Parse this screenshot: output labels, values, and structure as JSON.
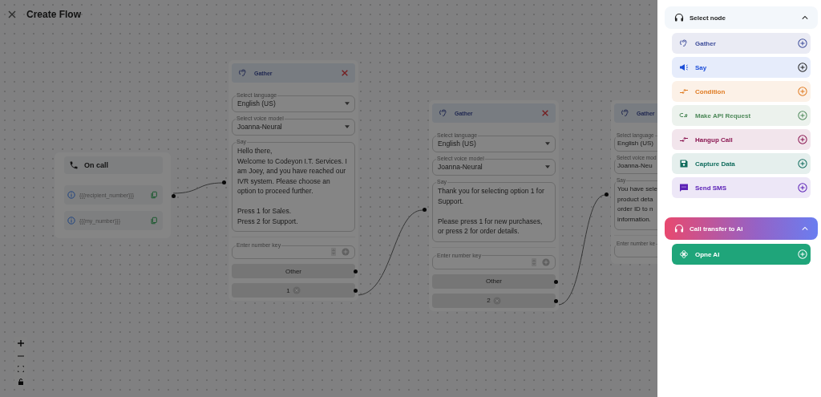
{
  "header": {
    "title": "Create Flow"
  },
  "nodes": [
    {
      "kind": "start",
      "title": "On call",
      "variables": [
        "{{{recipient_number}}}",
        "{{{my_number}}}"
      ]
    },
    {
      "kind": "gather",
      "title": "Gather",
      "closable": true,
      "language_label": "Select language",
      "language": "English (US)",
      "voice_label": "Select voice model",
      "voice": "Joanna-Neural",
      "say_label": "Say",
      "say": "Hello there,\nWelcome to Codeyon I.T. Services. I am Joey, and you have reached our IVR system. Please choose an option to proceed further.\n\nPress 1 for Sales.\nPress 2 for Support.",
      "number_label": "Enter number key",
      "options": [
        {
          "kind": "other",
          "label": "Other"
        },
        {
          "kind": "key",
          "label": "1"
        }
      ]
    },
    {
      "kind": "gather",
      "title": "Gather",
      "closable": true,
      "language_label": "Select language",
      "language": "English (US)",
      "voice_label": "Select voice model",
      "voice": "Joanna-Neural",
      "say_label": "Say",
      "say": "Thank you for selecting option 1 for Support.\n\nPlease press 1 for new purchases, or press 2 for order details.",
      "number_label": "Enter number key",
      "options": [
        {
          "kind": "other",
          "label": "Other"
        },
        {
          "kind": "key",
          "label": "2"
        }
      ]
    },
    {
      "kind": "gather",
      "title": "Gather",
      "closable": false,
      "language_label": "Select language",
      "language": "English (US)",
      "voice_label": "Select voice mod",
      "voice": "Joanna-Neu",
      "say_label": "Say",
      "say": "You have sele\nproduct deta\norder ID to n\ninformation.",
      "number_label": "Enter number ke"
    }
  ],
  "drawer": {
    "sections": [
      {
        "kind": "plain",
        "title": "Select node",
        "expanded": true,
        "items": [
          {
            "kind": "gather",
            "label": "Gather",
            "color": "#3d4c9a"
          },
          {
            "kind": "say",
            "label": "Say",
            "color": "#1d4ed8"
          },
          {
            "kind": "condition",
            "label": "Condition",
            "color": "#e07b22"
          },
          {
            "kind": "api",
            "label": "Make API Request",
            "color": "#4f8a5b"
          },
          {
            "kind": "hangup",
            "label": "Hangup Call",
            "color": "#8a1550"
          },
          {
            "kind": "capture",
            "label": "Capture Data",
            "color": "#0f6b5c"
          },
          {
            "kind": "sms",
            "label": "Send SMS",
            "color": "#5b21b6"
          }
        ]
      },
      {
        "kind": "gradient",
        "title": "Call transfer to Ai",
        "expanded": true,
        "items": [
          {
            "kind": "openai",
            "label": "Opne AI",
            "color": "#1fa57a"
          }
        ]
      }
    ]
  }
}
